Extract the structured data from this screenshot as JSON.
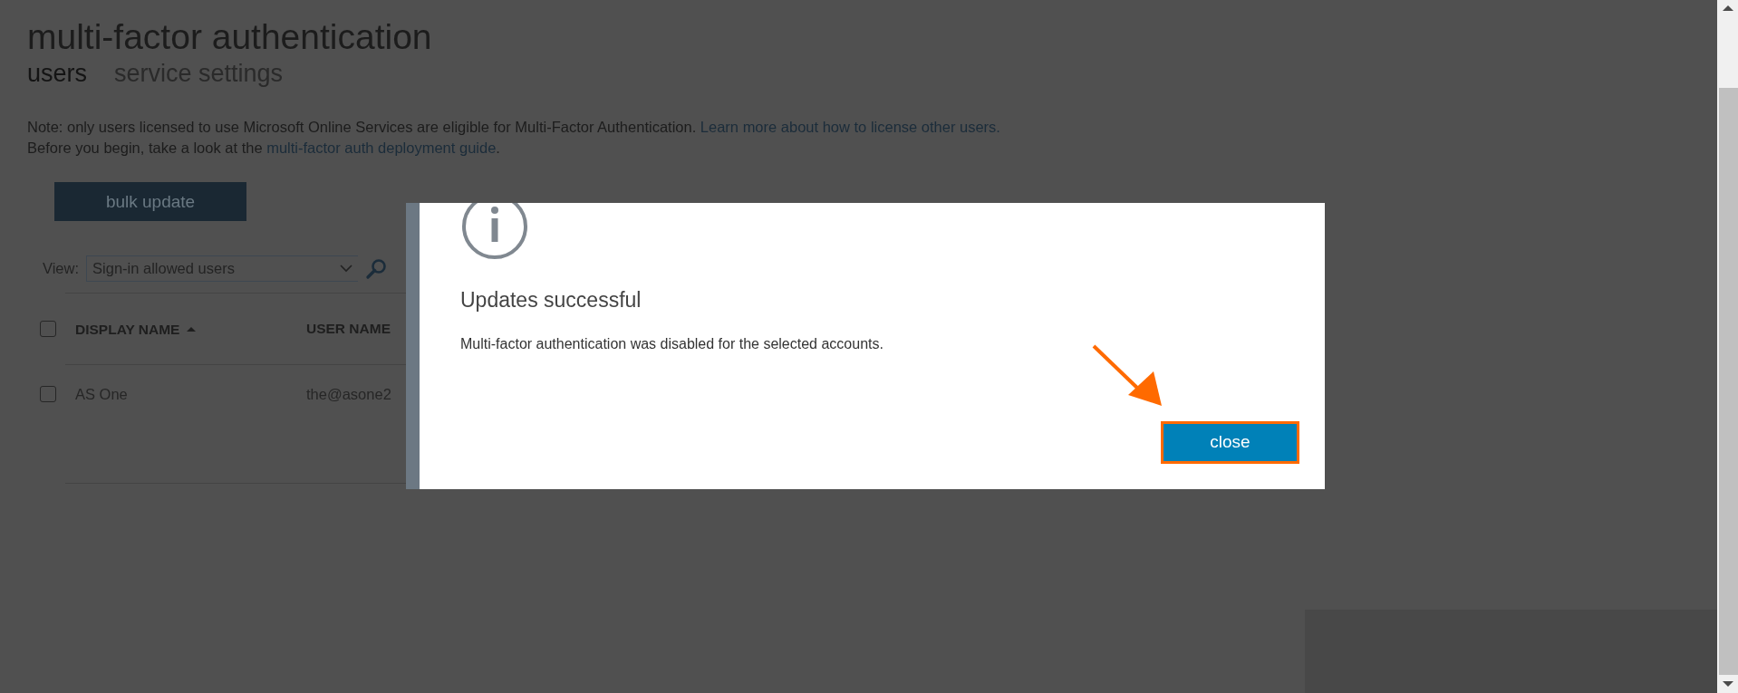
{
  "page": {
    "title": "multi-factor authentication"
  },
  "tabs": [
    {
      "label": "users",
      "selected": true
    },
    {
      "label": "service settings",
      "selected": false
    }
  ],
  "notes": [
    [
      {
        "text": "Note: only users licensed to use Microsoft Online Services are eligible for Multi-Factor Authentication. "
      },
      {
        "link": "Learn more about how to license other users."
      }
    ],
    [
      {
        "text": "Before you begin, take a look at the "
      },
      {
        "link": "multi-factor auth deployment guide"
      },
      {
        "text": "."
      }
    ]
  ],
  "bulk_update_button": "bulk update",
  "view": {
    "label": "View:",
    "value": "Sign-in allowed users"
  },
  "table": {
    "select_all_checked": false,
    "columns": [
      {
        "label": "DISPLAY NAME",
        "sorted": true
      },
      {
        "label": "USER NAME",
        "sorted": false
      }
    ],
    "rows": [
      {
        "checked": false,
        "cells": [
          "AS One",
          "the@asone2"
        ]
      }
    ]
  },
  "dialog": {
    "title": "Updates successful",
    "message": "Multi-factor authentication was disabled for the selected accounts.",
    "button": "close",
    "button_highlighted": true
  }
}
